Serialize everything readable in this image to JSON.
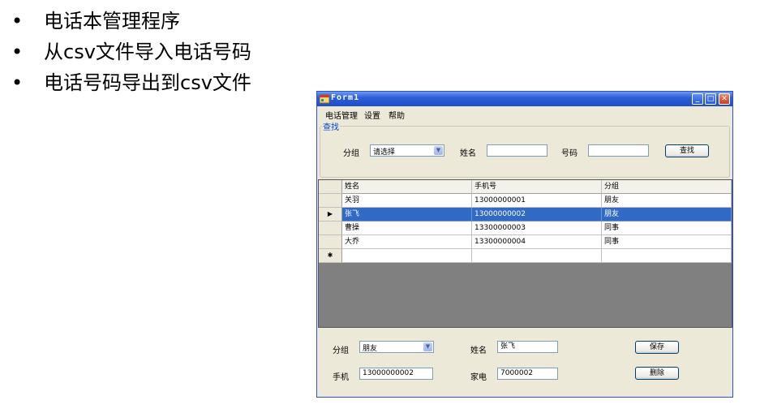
{
  "slide": {
    "bullets": [
      {
        "marker": "•",
        "text": "电话本管理程序"
      },
      {
        "marker": "•",
        "text": "从csv文件导入电话号码"
      },
      {
        "marker": "•",
        "text": "电话号码导出到csv文件"
      }
    ]
  },
  "window": {
    "title": "Form1",
    "app_icon": "form-app-icon",
    "minimize_glyph": "_",
    "maximize_glyph": "□",
    "close_glyph": "✕"
  },
  "menu": [
    "电话管理",
    "设置",
    "帮助"
  ],
  "search": {
    "group_title": "查找",
    "group_label": "分组",
    "group_value": "请选择",
    "name_label": "姓名",
    "name_value": "",
    "number_label": "号码",
    "number_value": "",
    "search_button": "查找"
  },
  "grid": {
    "columns": [
      "姓名",
      "手机号",
      "分组"
    ],
    "rows": [
      {
        "name": "关羽",
        "phone": "13000000001",
        "group": "朋友",
        "selected": false
      },
      {
        "name": "张飞",
        "phone": "13000000002",
        "group": "朋友",
        "selected": true
      },
      {
        "name": "曹操",
        "phone": "13300000003",
        "group": "同事",
        "selected": false
      },
      {
        "name": "大乔",
        "phone": "13300000004",
        "group": "同事",
        "selected": false
      }
    ],
    "current_row_marker": "▶",
    "new_row_marker": "✱"
  },
  "detail": {
    "group_label": "分组",
    "group_value": "朋友",
    "name_label": "姓名",
    "name_value": "张飞",
    "mobile_label": "手机",
    "mobile_value": "13000000002",
    "home_label": "家电",
    "home_value": "7000002",
    "save_button": "保存",
    "delete_button": "删除"
  },
  "colors": {
    "selection": "#316ac5",
    "titlebar": "#2c5fd9",
    "window_bg": "#ece9d8",
    "grid_empty": "#808080"
  }
}
